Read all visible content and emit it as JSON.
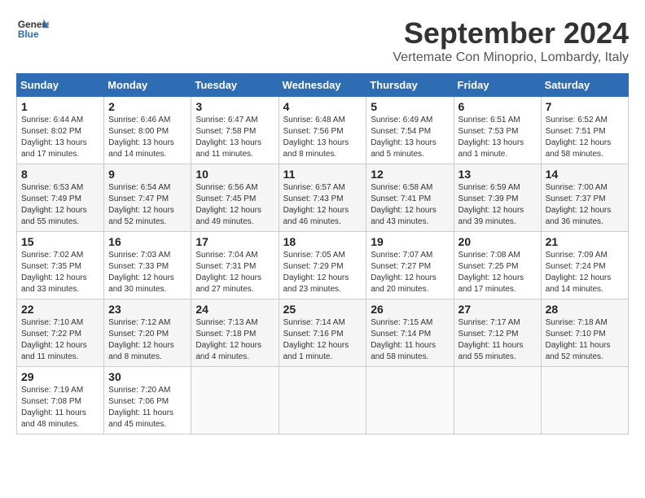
{
  "header": {
    "logo_line1": "General",
    "logo_line2": "Blue",
    "month": "September 2024",
    "location": "Vertemate Con Minoprio, Lombardy, Italy"
  },
  "weekdays": [
    "Sunday",
    "Monday",
    "Tuesday",
    "Wednesday",
    "Thursday",
    "Friday",
    "Saturday"
  ],
  "weeks": [
    [
      {
        "day": "1",
        "info": "Sunrise: 6:44 AM\nSunset: 8:02 PM\nDaylight: 13 hours and 17 minutes."
      },
      {
        "day": "2",
        "info": "Sunrise: 6:46 AM\nSunset: 8:00 PM\nDaylight: 13 hours and 14 minutes."
      },
      {
        "day": "3",
        "info": "Sunrise: 6:47 AM\nSunset: 7:58 PM\nDaylight: 13 hours and 11 minutes."
      },
      {
        "day": "4",
        "info": "Sunrise: 6:48 AM\nSunset: 7:56 PM\nDaylight: 13 hours and 8 minutes."
      },
      {
        "day": "5",
        "info": "Sunrise: 6:49 AM\nSunset: 7:54 PM\nDaylight: 13 hours and 5 minutes."
      },
      {
        "day": "6",
        "info": "Sunrise: 6:51 AM\nSunset: 7:53 PM\nDaylight: 13 hours and 1 minute."
      },
      {
        "day": "7",
        "info": "Sunrise: 6:52 AM\nSunset: 7:51 PM\nDaylight: 12 hours and 58 minutes."
      }
    ],
    [
      {
        "day": "8",
        "info": "Sunrise: 6:53 AM\nSunset: 7:49 PM\nDaylight: 12 hours and 55 minutes."
      },
      {
        "day": "9",
        "info": "Sunrise: 6:54 AM\nSunset: 7:47 PM\nDaylight: 12 hours and 52 minutes."
      },
      {
        "day": "10",
        "info": "Sunrise: 6:56 AM\nSunset: 7:45 PM\nDaylight: 12 hours and 49 minutes."
      },
      {
        "day": "11",
        "info": "Sunrise: 6:57 AM\nSunset: 7:43 PM\nDaylight: 12 hours and 46 minutes."
      },
      {
        "day": "12",
        "info": "Sunrise: 6:58 AM\nSunset: 7:41 PM\nDaylight: 12 hours and 43 minutes."
      },
      {
        "day": "13",
        "info": "Sunrise: 6:59 AM\nSunset: 7:39 PM\nDaylight: 12 hours and 39 minutes."
      },
      {
        "day": "14",
        "info": "Sunrise: 7:00 AM\nSunset: 7:37 PM\nDaylight: 12 hours and 36 minutes."
      }
    ],
    [
      {
        "day": "15",
        "info": "Sunrise: 7:02 AM\nSunset: 7:35 PM\nDaylight: 12 hours and 33 minutes."
      },
      {
        "day": "16",
        "info": "Sunrise: 7:03 AM\nSunset: 7:33 PM\nDaylight: 12 hours and 30 minutes."
      },
      {
        "day": "17",
        "info": "Sunrise: 7:04 AM\nSunset: 7:31 PM\nDaylight: 12 hours and 27 minutes."
      },
      {
        "day": "18",
        "info": "Sunrise: 7:05 AM\nSunset: 7:29 PM\nDaylight: 12 hours and 23 minutes."
      },
      {
        "day": "19",
        "info": "Sunrise: 7:07 AM\nSunset: 7:27 PM\nDaylight: 12 hours and 20 minutes."
      },
      {
        "day": "20",
        "info": "Sunrise: 7:08 AM\nSunset: 7:25 PM\nDaylight: 12 hours and 17 minutes."
      },
      {
        "day": "21",
        "info": "Sunrise: 7:09 AM\nSunset: 7:24 PM\nDaylight: 12 hours and 14 minutes."
      }
    ],
    [
      {
        "day": "22",
        "info": "Sunrise: 7:10 AM\nSunset: 7:22 PM\nDaylight: 12 hours and 11 minutes."
      },
      {
        "day": "23",
        "info": "Sunrise: 7:12 AM\nSunset: 7:20 PM\nDaylight: 12 hours and 8 minutes."
      },
      {
        "day": "24",
        "info": "Sunrise: 7:13 AM\nSunset: 7:18 PM\nDaylight: 12 hours and 4 minutes."
      },
      {
        "day": "25",
        "info": "Sunrise: 7:14 AM\nSunset: 7:16 PM\nDaylight: 12 hours and 1 minute."
      },
      {
        "day": "26",
        "info": "Sunrise: 7:15 AM\nSunset: 7:14 PM\nDaylight: 11 hours and 58 minutes."
      },
      {
        "day": "27",
        "info": "Sunrise: 7:17 AM\nSunset: 7:12 PM\nDaylight: 11 hours and 55 minutes."
      },
      {
        "day": "28",
        "info": "Sunrise: 7:18 AM\nSunset: 7:10 PM\nDaylight: 11 hours and 52 minutes."
      }
    ],
    [
      {
        "day": "29",
        "info": "Sunrise: 7:19 AM\nSunset: 7:08 PM\nDaylight: 11 hours and 48 minutes."
      },
      {
        "day": "30",
        "info": "Sunrise: 7:20 AM\nSunset: 7:06 PM\nDaylight: 11 hours and 45 minutes."
      },
      {
        "day": "",
        "info": ""
      },
      {
        "day": "",
        "info": ""
      },
      {
        "day": "",
        "info": ""
      },
      {
        "day": "",
        "info": ""
      },
      {
        "day": "",
        "info": ""
      }
    ]
  ]
}
